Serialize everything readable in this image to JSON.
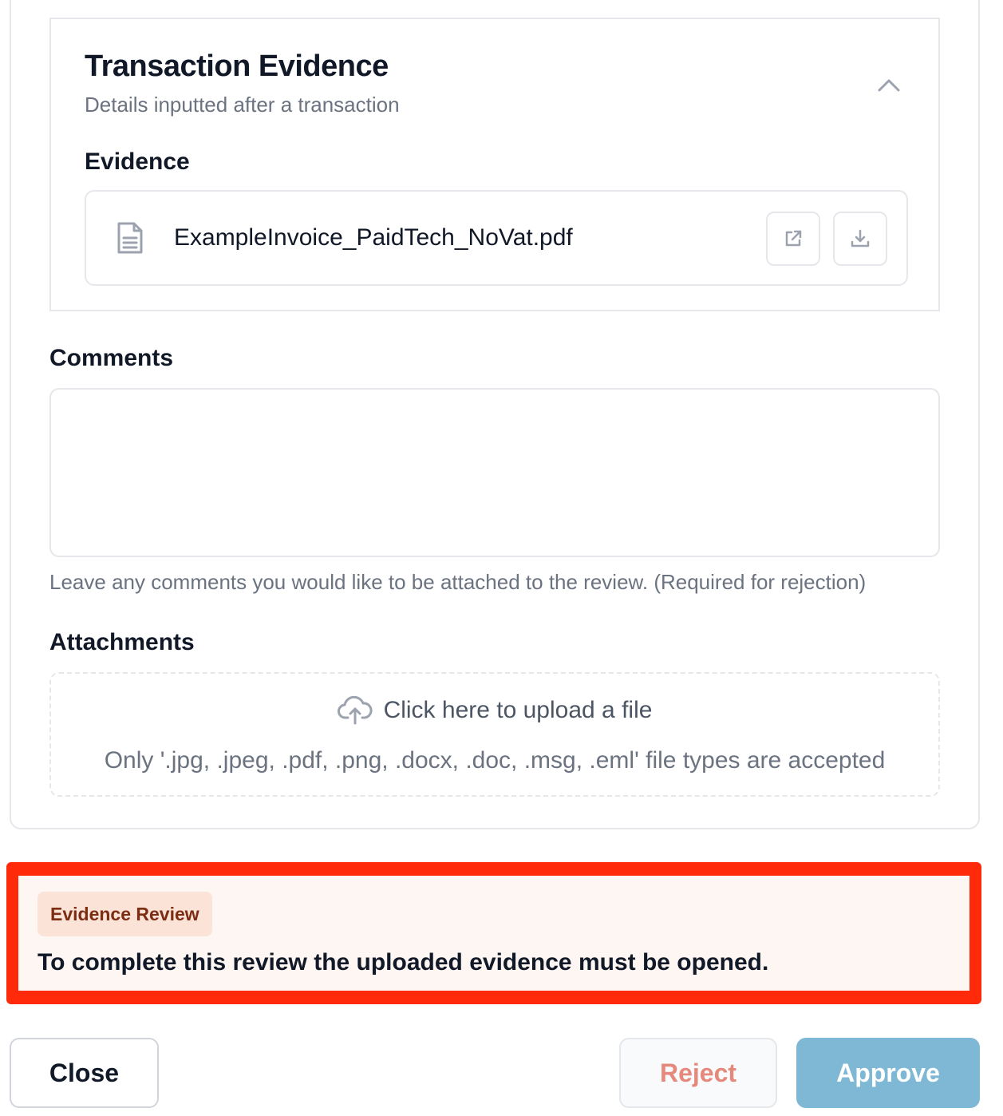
{
  "evidence_section": {
    "title": "Transaction Evidence",
    "subtitle": "Details inputted after a transaction",
    "collapse_icon": "chevron-up-icon",
    "evidence_label": "Evidence",
    "file": {
      "name": "ExampleInvoice_PaidTech_NoVat.pdf",
      "icon": "document-icon",
      "open_icon": "external-link-icon",
      "download_icon": "download-icon"
    }
  },
  "comments": {
    "label": "Comments",
    "value": "",
    "help_text": "Leave any comments you would like to be attached to the review. (Required for rejection)"
  },
  "attachments": {
    "label": "Attachments",
    "upload_icon": "cloud-upload-icon",
    "upload_prompt": "Click here to upload a file",
    "accepted_types": "Only '.jpg, .jpeg, .pdf, .png, .docx, .doc, .msg, .eml' file types are accepted"
  },
  "alert": {
    "badge": "Evidence Review",
    "message": "To complete this review the uploaded evidence must be opened.",
    "border_color": "#ff2a0a",
    "background_color": "#fdf6f2"
  },
  "footer": {
    "close_label": "Close",
    "reject_label": "Reject",
    "approve_label": "Approve",
    "reject_color": "#e5897c",
    "approve_color": "#7fb8d4"
  }
}
